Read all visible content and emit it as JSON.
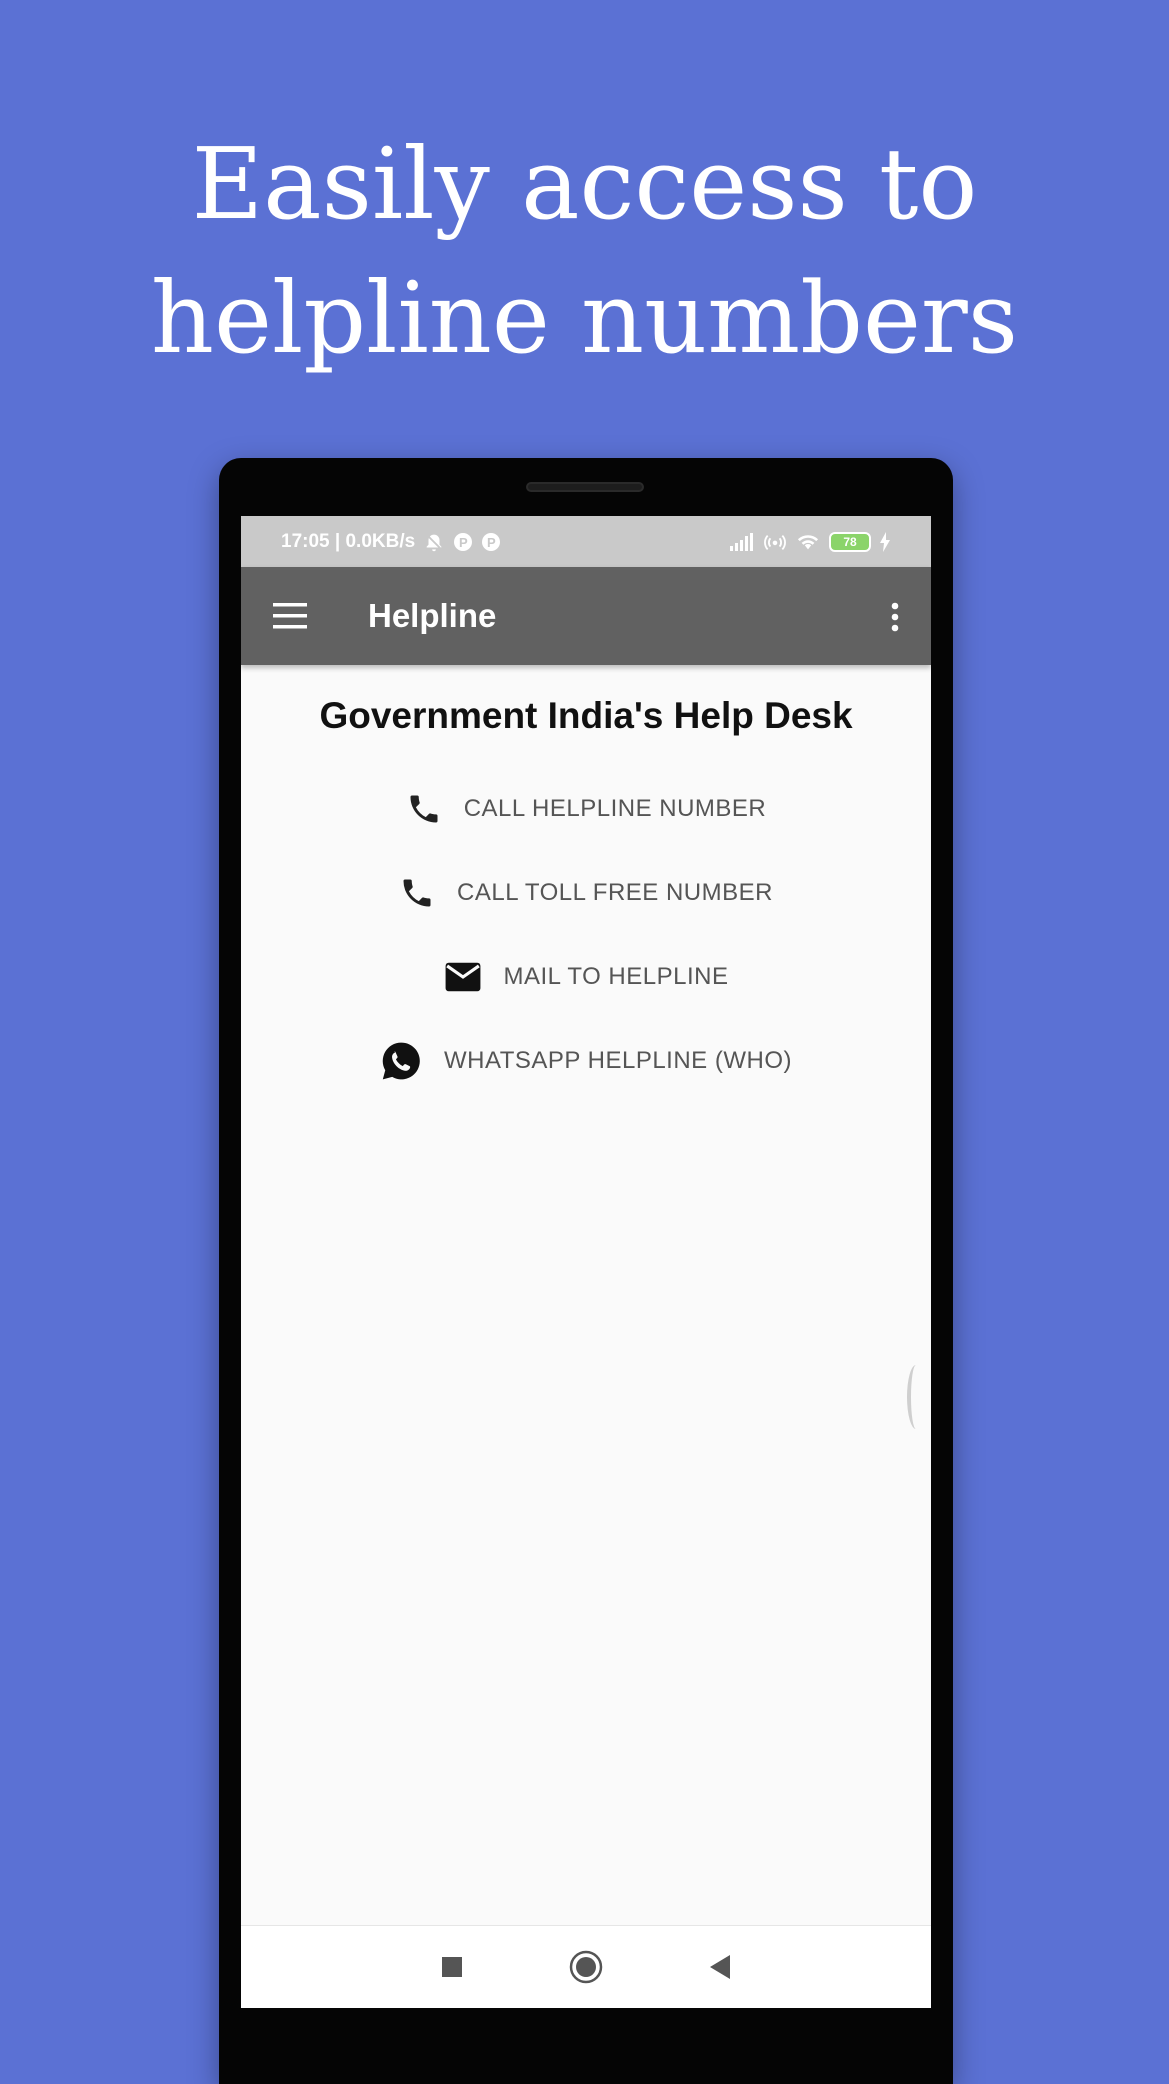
{
  "headline": "Easily access to helpline numbers",
  "status_bar": {
    "left_text": "17:05 | 0.0KB/s",
    "battery": "78",
    "icons": [
      "alarm-off-icon",
      "p-app-icon",
      "p-app-icon",
      "signal-icon",
      "hotspot-icon",
      "wifi-icon",
      "battery-icon",
      "charging-icon"
    ]
  },
  "app_bar": {
    "title": "Helpline",
    "menu_icon": "hamburger-menu-icon",
    "overflow_icon": "more-vert-icon"
  },
  "page": {
    "title": "Government India's Help Desk",
    "actions": [
      {
        "label": "CALL HELPLINE NUMBER",
        "icon": "phone-icon"
      },
      {
        "label": "CALL TOLL FREE NUMBER",
        "icon": "phone-icon"
      },
      {
        "label": "MAIL TO HELPLINE",
        "icon": "mail-icon"
      },
      {
        "label": "WHATSAPP HELPLINE (WHO)",
        "icon": "whatsapp-icon"
      }
    ]
  },
  "nav_bar": {
    "buttons": [
      "recents-square-icon",
      "home-circle-icon",
      "back-triangle-icon"
    ]
  },
  "colors": {
    "background": "#5b71d4",
    "app_bar": "#616161",
    "status_bar": "#c9c9c9",
    "screen": "#fafafa",
    "action_text": "#555555"
  }
}
